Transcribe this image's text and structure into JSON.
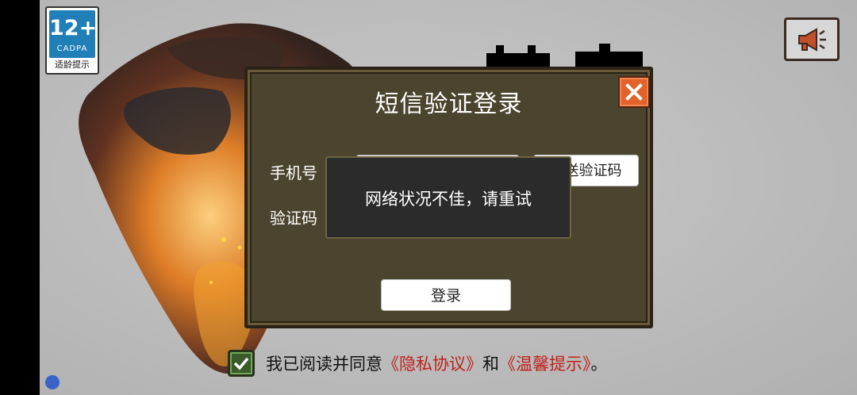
{
  "age_badge": {
    "rating": "12+",
    "org": "CADPA",
    "tip": "适龄提示"
  },
  "dialog": {
    "title": "短信验证登录",
    "phone_label": "手机号",
    "code_label": "验证码",
    "phone_value": "",
    "code_value": "",
    "send_code_label": "发送验证码",
    "login_label": "登录"
  },
  "toast": {
    "message": "网络状况不佳，请重试"
  },
  "agreement": {
    "checked": true,
    "prefix": "我已阅读并同意",
    "privacy_link": "《隐私协议》",
    "and": "和",
    "tips_link": "《温馨提示》",
    "suffix": "。"
  },
  "colors": {
    "accent_close": "#e1622a",
    "dialog_bg": "#4b442e",
    "link": "#c0201a",
    "badge_blue": "#1f7fb6"
  },
  "icons": {
    "sound": "megaphone-icon",
    "close": "close-icon",
    "check": "checkmark-icon"
  }
}
